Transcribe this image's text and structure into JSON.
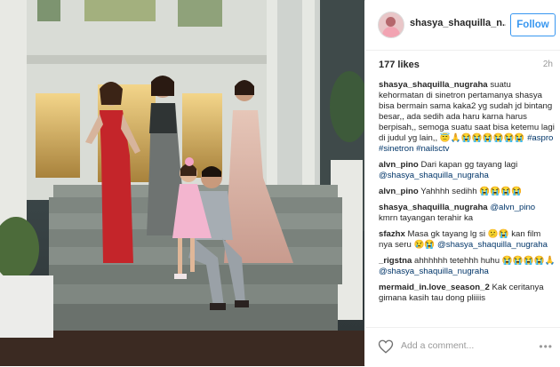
{
  "post": {
    "username": "shasya_shaquilla_n...",
    "follow_label": "Follow",
    "likes": "177 likes",
    "time": "2h"
  },
  "comments": [
    {
      "user": "shasya_shaquilla_nugraha",
      "text": "suatu kehormatan di sinetron pertamanya shasya bisa bermain sama kaka2 yg sudah jd bintang besar,, ada sedih ada haru karna harus berpisah,, semoga suatu saat bisa ketemu lagi di judul yg lain,,",
      "emoji": "😇🙏😭😭😭😭😭😭",
      "tags": "#aspro #sinetron #nailsctv"
    },
    {
      "user": "alvn_pino",
      "text": "Dari kapan gg tayang lagi",
      "mention": "@shasya_shaquilla_nugraha"
    },
    {
      "user": "alvn_pino",
      "text": "Yahhhh sedihh",
      "emoji": "😭😭😭😭"
    },
    {
      "user": "shasya_shaquilla_nugraha",
      "mention": "@alvn_pino",
      "text": "kmrn tayangan terahir ka"
    },
    {
      "user": "sfazhx",
      "text": "Masa gk tayang lg si",
      "emoji": "😕😭",
      "text2": "kan film nya seru",
      "emoji2": "😢😭",
      "mention": "@shasya_shaquilla_nugraha"
    },
    {
      "user": "_rigstna",
      "text": "ahhhhhh tetehhh huhu",
      "emoji": "😭😭😭😭🙏",
      "mention": "@shasya_shaquilla_nugraha"
    },
    {
      "user": "mermaid_in.love_season_2",
      "text": "Kak ceritanya gimana kasih tau dong pliiiis"
    }
  ],
  "footer": {
    "add_comment_placeholder": "Add a comment...",
    "more_glyph": "•••"
  },
  "colors": {
    "accent": "#3897f0",
    "link": "#003569",
    "text": "#262626",
    "muted": "#999999"
  },
  "icons": {
    "like": "heart-outline-icon",
    "more": "more-options-icon"
  }
}
